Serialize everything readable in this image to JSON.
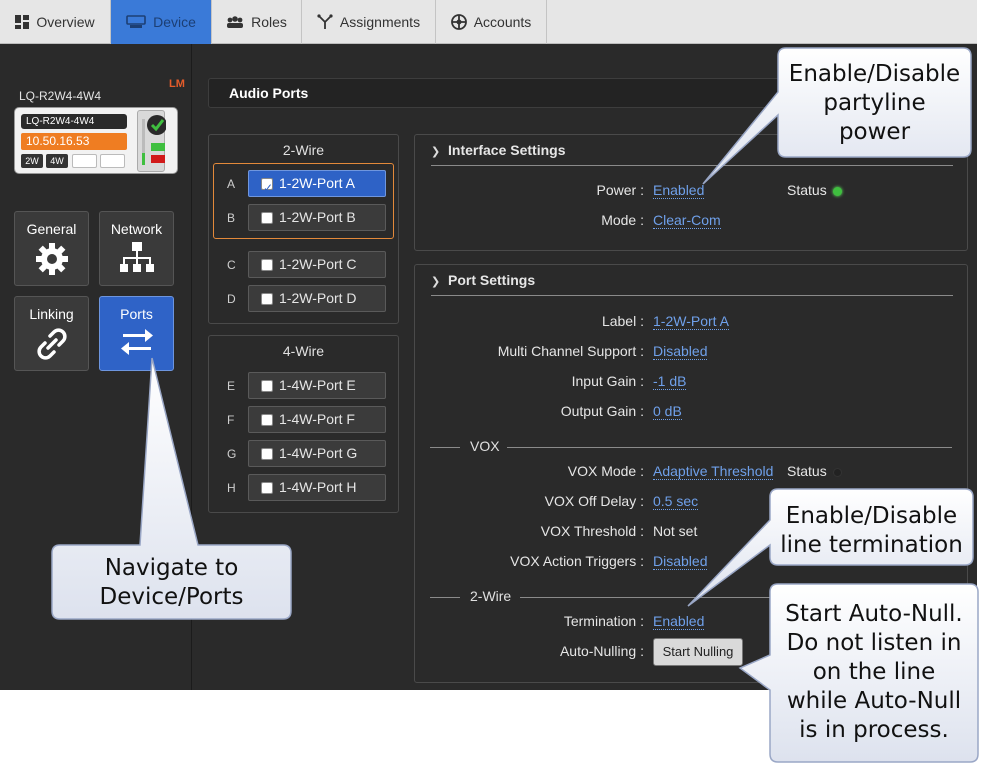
{
  "nav": {
    "tabs": [
      {
        "label": "Overview",
        "icon": "dashboard-icon",
        "active": false
      },
      {
        "label": "Device",
        "icon": "device-icon",
        "active": true
      },
      {
        "label": "Roles",
        "icon": "roles-icon",
        "active": false
      },
      {
        "label": "Assignments",
        "icon": "assignments-icon",
        "active": false
      },
      {
        "label": "Accounts",
        "icon": "accounts-icon",
        "active": false
      }
    ]
  },
  "device": {
    "name": "LQ-R2W4-4W4",
    "badge": "LM",
    "model": "LQ-R2W4-4W4",
    "ip": "10.50.16.53",
    "chips": [
      "2W",
      "4W"
    ]
  },
  "sidebar": {
    "buttons": [
      {
        "label": "General",
        "icon": "gear-icon",
        "active": false
      },
      {
        "label": "Network",
        "icon": "network-icon",
        "active": false
      },
      {
        "label": "Linking",
        "icon": "link-icon",
        "active": false
      },
      {
        "label": "Ports",
        "icon": "ports-arrows-icon",
        "active": true
      }
    ]
  },
  "audio_ports": {
    "title": "Audio Ports",
    "two_wire": {
      "title": "2-Wire",
      "ports": [
        {
          "letter": "A",
          "label": "1-2W-Port A",
          "checked": true
        },
        {
          "letter": "B",
          "label": "1-2W-Port B",
          "checked": false
        },
        {
          "letter": "C",
          "label": "1-2W-Port C",
          "checked": false
        },
        {
          "letter": "D",
          "label": "1-2W-Port D",
          "checked": false
        }
      ]
    },
    "four_wire": {
      "title": "4-Wire",
      "ports": [
        {
          "letter": "E",
          "label": "1-4W-Port E",
          "checked": false
        },
        {
          "letter": "F",
          "label": "1-4W-Port F",
          "checked": false
        },
        {
          "letter": "G",
          "label": "1-4W-Port G",
          "checked": false
        },
        {
          "letter": "H",
          "label": "1-4W-Port H",
          "checked": false
        }
      ]
    }
  },
  "interface_settings": {
    "title": "Interface Settings",
    "power_label": "Power :",
    "power_value": "Enabled",
    "status_label": "Status",
    "status_color": "#3fbf3f",
    "mode_label": "Mode :",
    "mode_value": "Clear-Com"
  },
  "port_settings": {
    "title": "Port Settings",
    "label_label": "Label :",
    "label_value": "1-2W-Port A",
    "mcs_label": "Multi Channel Support :",
    "mcs_value": "Disabled",
    "input_gain_label": "Input Gain :",
    "input_gain_value": "-1 dB",
    "output_gain_label": "Output Gain :",
    "output_gain_value": "0 dB",
    "vox_heading": "VOX",
    "vox_mode_label": "VOX Mode :",
    "vox_mode_value": "Adaptive Threshold",
    "vox_status_label": "Status",
    "vox_status_color": "#222222",
    "vox_off_delay_label": "VOX Off Delay :",
    "vox_off_delay_value": "0.5 sec",
    "vox_threshold_label": "VOX Threshold :",
    "vox_threshold_value": "Not set",
    "vox_triggers_label": "VOX Action Triggers :",
    "vox_triggers_value": "Disabled",
    "two_wire_heading": "2-Wire",
    "termination_label": "Termination :",
    "termination_value": "Enabled",
    "autonull_label": "Auto-Nulling :",
    "autonull_button": "Start Nulling"
  },
  "callouts": {
    "power": [
      "Enable/Disable",
      "partyline",
      "power"
    ],
    "navigate": [
      "Navigate to",
      "Device/Ports"
    ],
    "termination": [
      "Enable/Disable",
      "line termination"
    ],
    "autonull": [
      "Start Auto-Null.",
      "Do not listen in",
      "on the line",
      "while Auto-Null",
      "is in process."
    ]
  },
  "colors": {
    "accent": "#2f63c7",
    "selection_outline": "#e3893a",
    "link": "#6fa0ea",
    "ip_badge": "#ef7d22"
  }
}
